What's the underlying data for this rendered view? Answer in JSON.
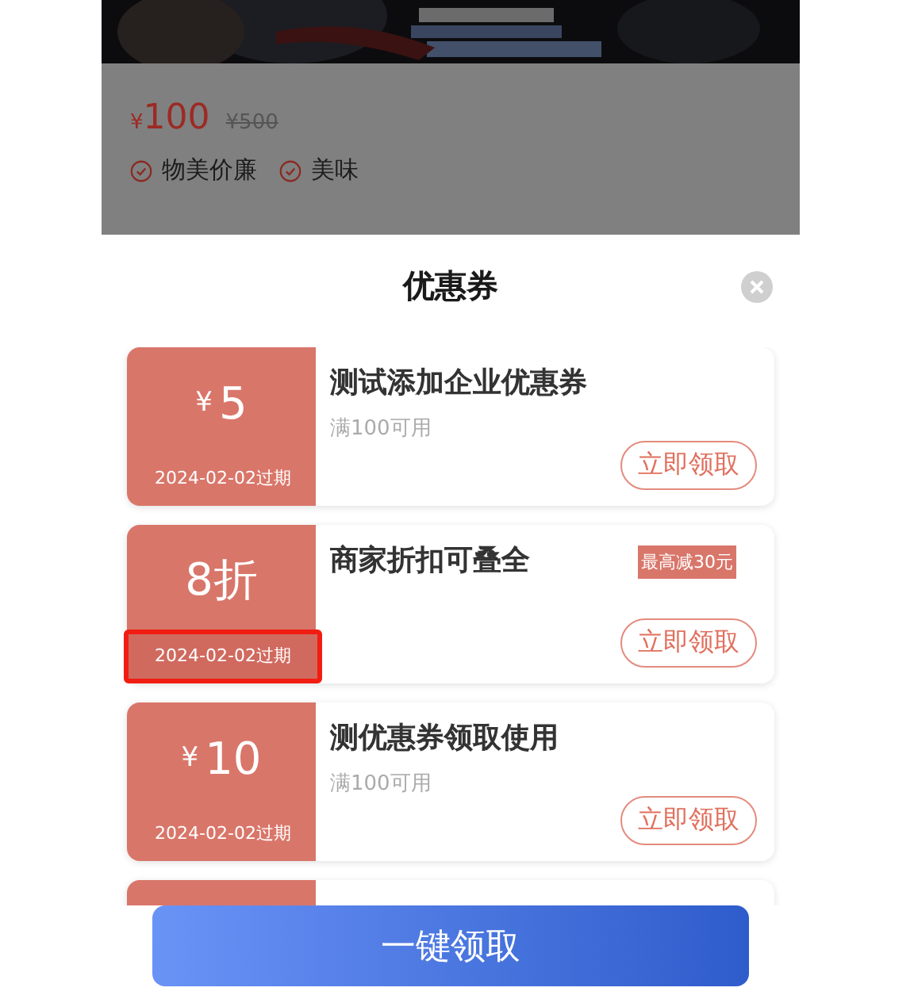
{
  "product": {
    "currency": "¥",
    "price": "100",
    "original_price": "¥500",
    "tags": [
      "物美价廉",
      "美味"
    ]
  },
  "sheet": {
    "title": "优惠券",
    "coupons": [
      {
        "kind": "amount",
        "currency": "¥",
        "value": "5",
        "expiry": "2024-02-02过期",
        "title": "测试添加企业优惠券",
        "condition": "满100可用",
        "button": "立即领取",
        "highlighted": false
      },
      {
        "kind": "discount",
        "value": "8折",
        "expiry": "2024-02-02过期",
        "title": "商家折扣可叠全",
        "badge": "最高减30元",
        "button": "立即领取",
        "highlighted": true
      },
      {
        "kind": "amount",
        "currency": "¥",
        "value": "10",
        "expiry": "2024-02-02过期",
        "title": "测优惠券领取使用",
        "condition": "满100可用",
        "button": "立即领取",
        "highlighted": false
      }
    ]
  },
  "claim_all_button": "一键领取"
}
